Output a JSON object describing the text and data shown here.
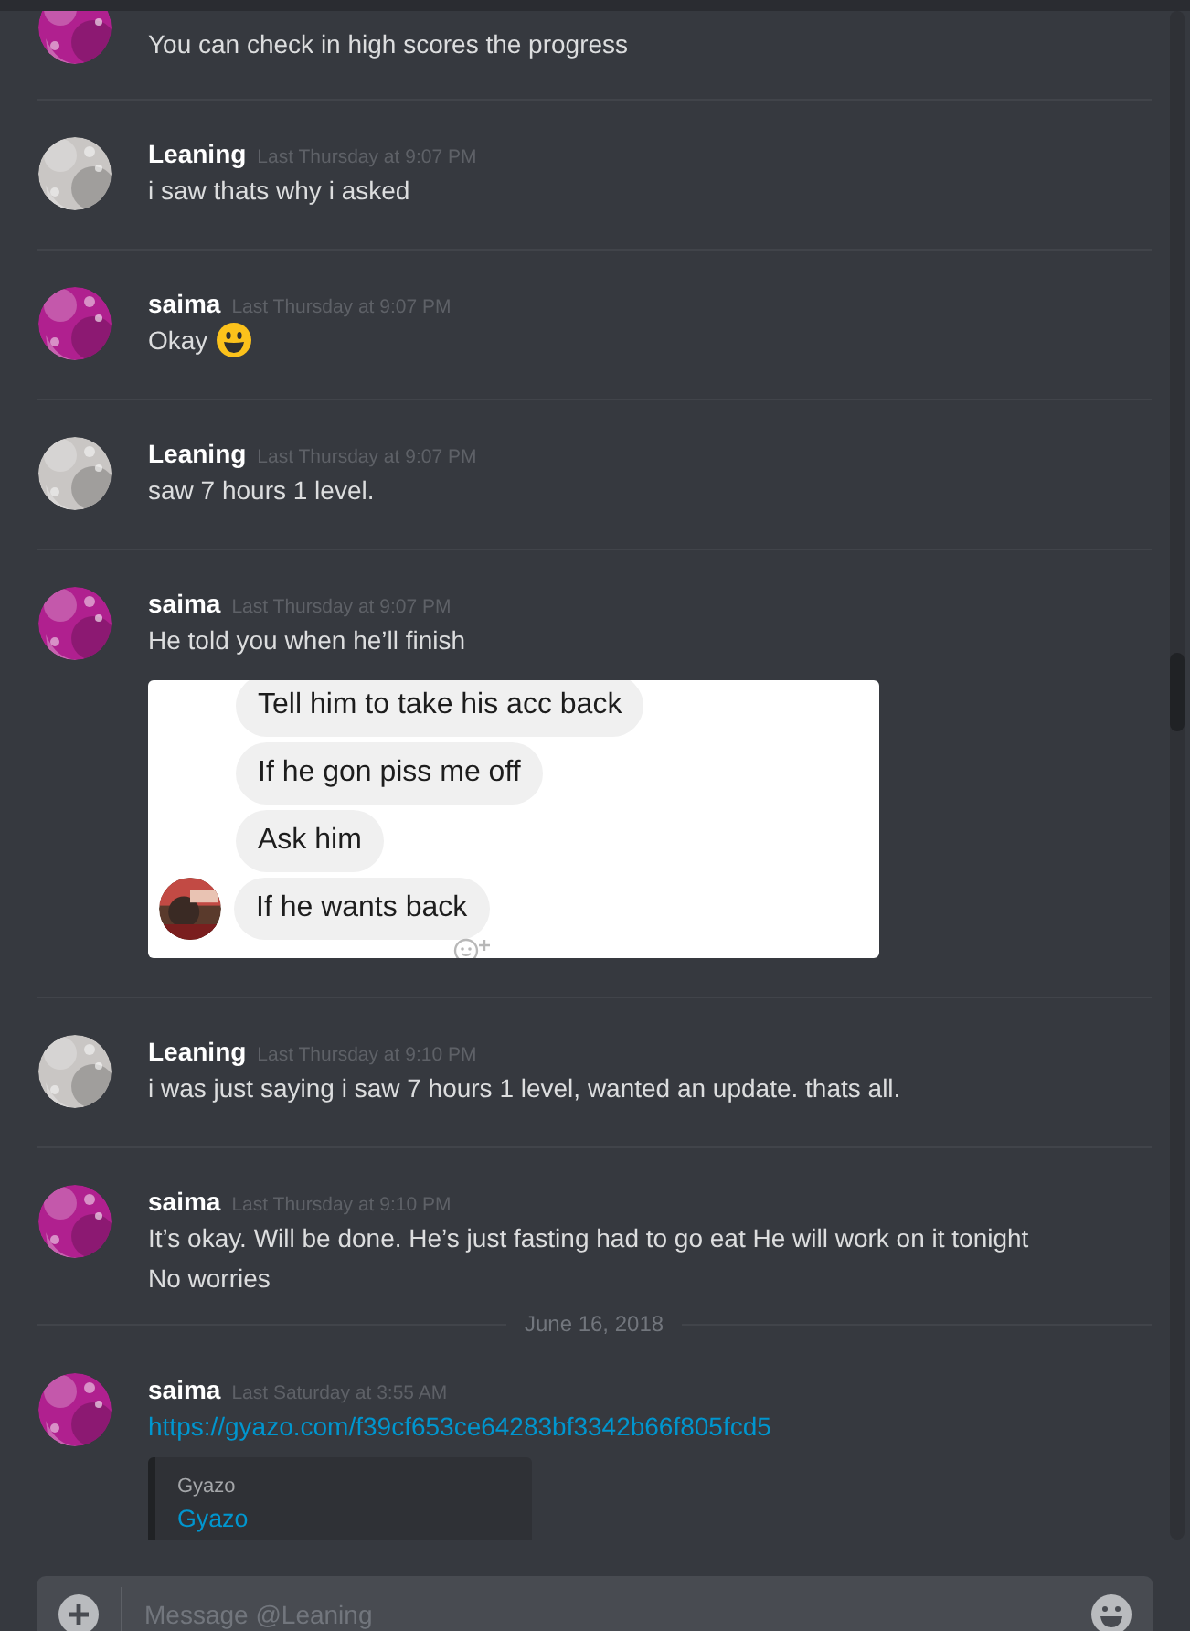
{
  "messages": [
    {
      "kind": "message",
      "avatar": {
        "kind": "picture",
        "color": "#b0208f"
      },
      "lines": [
        "You can check in high scores the progress"
      ]
    },
    {
      "kind": "message",
      "avatar": {
        "kind": "picture",
        "color": "#c9c6c4"
      },
      "author": "Leaning",
      "timestamp": "Last Thursday at 9:07 PM",
      "lines": [
        "i saw thats why i asked"
      ]
    },
    {
      "kind": "message",
      "avatar": {
        "kind": "picture",
        "color": "#b0208f"
      },
      "author": "saima",
      "timestamp": "Last Thursday at 9:07 PM",
      "lines": [
        "Okay"
      ],
      "emoji": true
    },
    {
      "kind": "message",
      "avatar": {
        "kind": "picture",
        "color": "#c9c6c4"
      },
      "author": "Leaning",
      "timestamp": "Last Thursday at 9:07 PM",
      "lines": [
        "saw 7 hours 1 level."
      ]
    },
    {
      "kind": "message",
      "avatar": {
        "kind": "picture",
        "color": "#b0208f"
      },
      "author": "saima",
      "timestamp": "Last Thursday at 9:07 PM",
      "lines": [
        "He told you when he’ll finish"
      ],
      "attachment": {
        "kind": "chat_screenshot",
        "bubbles": [
          "Tell him to take his acc back",
          "If he gon piss me off",
          "Ask him",
          "If he wants back"
        ]
      }
    },
    {
      "kind": "message",
      "avatar": {
        "kind": "picture",
        "color": "#c9c6c4"
      },
      "author": "Leaning",
      "timestamp": "Last Thursday at 9:10 PM",
      "lines": [
        "i was just saying i saw 7 hours 1 level, wanted an update. thats all."
      ]
    },
    {
      "kind": "message",
      "avatar": {
        "kind": "picture",
        "color": "#b0208f"
      },
      "author": "saima",
      "timestamp": "Last Thursday at 9:10 PM",
      "lines": [
        "It’s okay. Will be done. He’s just fasting had to go eat He will work on it tonight",
        "No worries"
      ]
    },
    {
      "kind": "date",
      "label": "June 16, 2018"
    },
    {
      "kind": "message",
      "avatar": {
        "kind": "picture",
        "color": "#b0208f"
      },
      "author": "saima",
      "timestamp": "Last Saturday at 3:55 AM",
      "link": "https://gyazo.com/f39cf653ce64283bf3342b66f805fcd5",
      "attachment": {
        "kind": "embed",
        "provider": "Gyazo",
        "title": "Gyazo"
      }
    }
  ],
  "composer": {
    "placeholder": "Message @Leaning"
  }
}
